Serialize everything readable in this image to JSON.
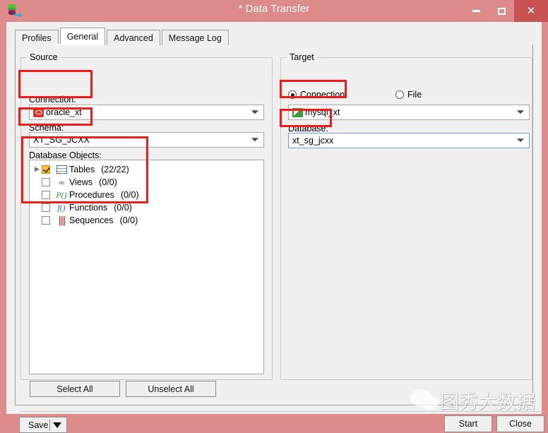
{
  "window": {
    "title": "* Data Transfer",
    "icon": "data-transfer-icon",
    "minimize": "–",
    "maximize": "□",
    "close": "✕"
  },
  "tabs": [
    {
      "label": "Profiles",
      "active": false
    },
    {
      "label": "General",
      "active": true
    },
    {
      "label": "Advanced",
      "active": false
    },
    {
      "label": "Message Log",
      "active": false
    }
  ],
  "source": {
    "group_title": "Source",
    "connection_label": "Connection:",
    "connection_value": "oracle_xt",
    "connection_icon": "oracle-connection-icon",
    "schema_label": "Schema:",
    "schema_value": "XT_SG_JCXX",
    "objects_label": "Database Objects:",
    "objects": [
      {
        "label": "Tables",
        "count": "(22/22)",
        "checked": true,
        "icon": "table-icon",
        "expandable": true
      },
      {
        "label": "Views",
        "count": "(0/0)",
        "checked": false,
        "icon": "view-icon",
        "expandable": false
      },
      {
        "label": "Procedures",
        "count": "(0/0)",
        "checked": false,
        "icon": "procedure-icon",
        "expandable": false
      },
      {
        "label": "Functions",
        "count": "(0/0)",
        "checked": false,
        "icon": "function-icon",
        "expandable": false
      },
      {
        "label": "Sequences",
        "count": "(0/0)",
        "checked": false,
        "icon": "sequence-icon",
        "expandable": false
      }
    ],
    "select_all": "Select All",
    "unselect_all": "Unselect All"
  },
  "target": {
    "group_title": "Target",
    "radio_connection": "Connection",
    "radio_file": "File",
    "radio_selected": "Connection",
    "connection_value": "mysql_xt",
    "connection_icon": "mysql-connection-icon",
    "database_label": "Database:",
    "database_value": "xt_sg_jcxx"
  },
  "footer": {
    "save": "Save",
    "start": "Start",
    "close": "Close"
  },
  "watermark": {
    "text": "图秀大数据",
    "logo": "wechat-logo"
  },
  "colors": {
    "titlebar": "#dd8b8b",
    "close_button": "#c85252",
    "annotation": "#ee1c1c",
    "client": "#f0f0f0",
    "focus_border": "#6ba3d6"
  }
}
